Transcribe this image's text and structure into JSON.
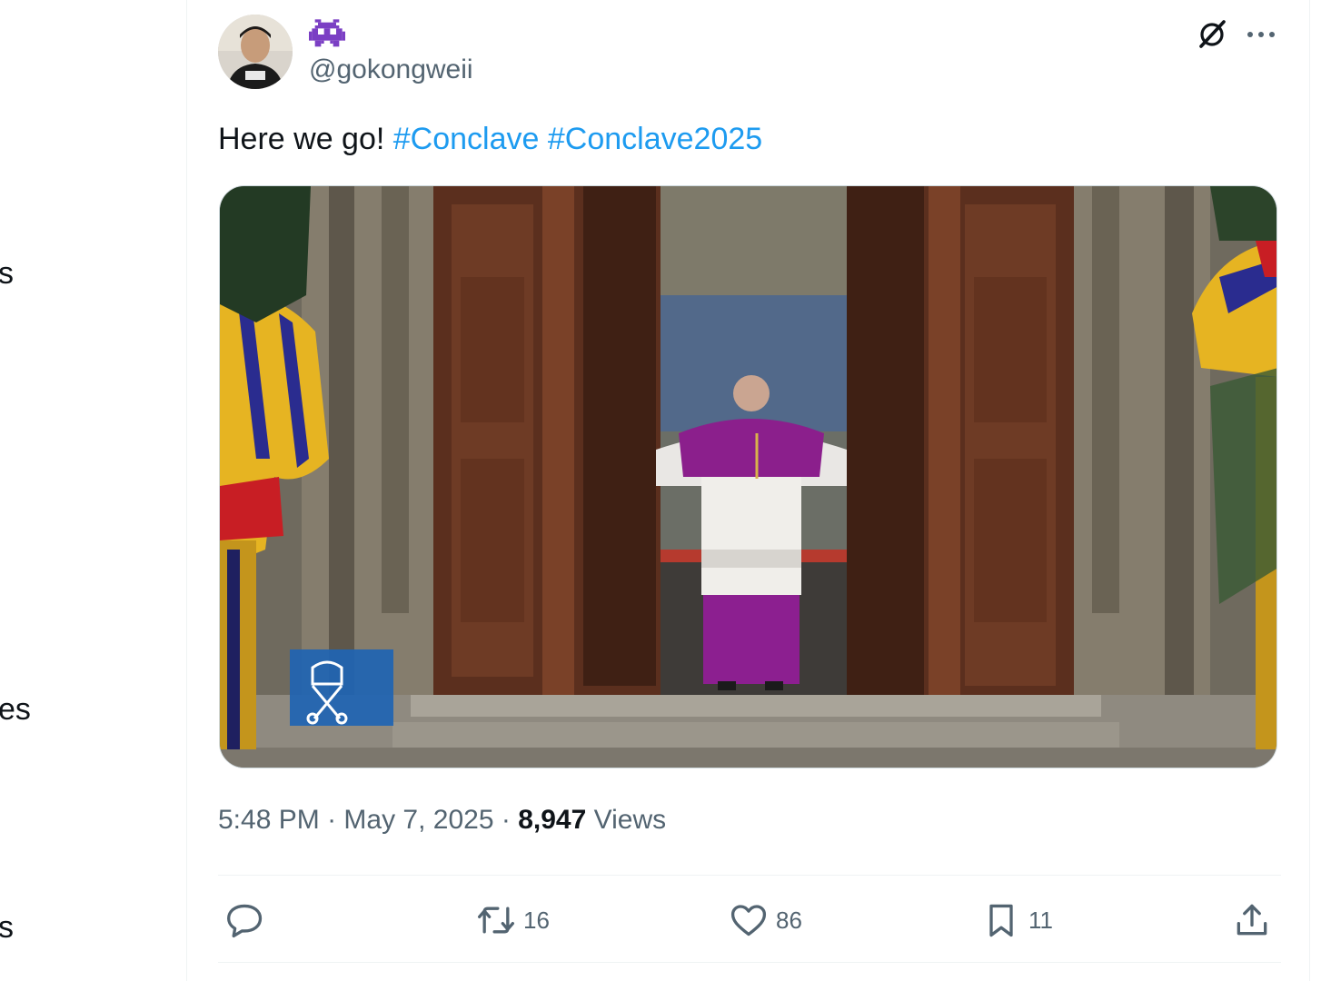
{
  "sidebar": {
    "fragments": [
      "s",
      "es",
      "s"
    ]
  },
  "tweet": {
    "handle": "@gokongweii",
    "text_prefix": "Here we go! ",
    "hashtags": [
      "#Conclave",
      "#Conclave2025"
    ],
    "time": "5:48 PM",
    "date": "May 7, 2025",
    "views_count": "8,947",
    "views_label": "Views",
    "separator": "·",
    "media_watermark": "VATICAN MEDIA",
    "stats": {
      "reposts": "16",
      "likes": "86",
      "bookmarks": "11"
    }
  },
  "icons": {
    "display_name_emoji": "alien-monster-icon",
    "grok": "grok-icon",
    "more": "more-icon",
    "reply": "reply-icon",
    "repost": "repost-icon",
    "like": "heart-icon",
    "bookmark": "bookmark-icon",
    "share": "share-icon"
  },
  "colors": {
    "accent": "#1d9bf0",
    "muted": "#536471",
    "text": "#0f1419",
    "emoji_purple": "#7b3fc4"
  }
}
